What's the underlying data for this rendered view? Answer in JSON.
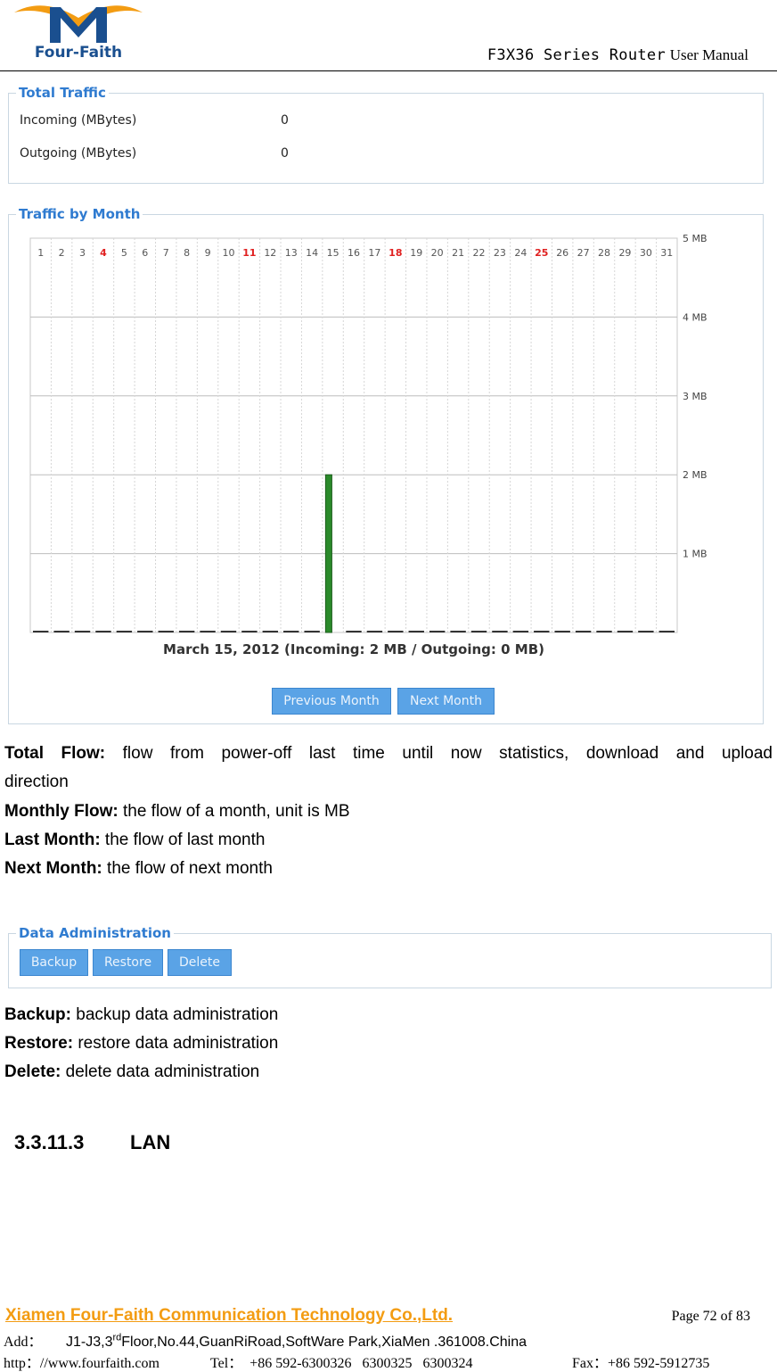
{
  "header": {
    "logo_text": "Four-Faith",
    "title_mono": "F3X36 Series Router",
    "title_serif": "User Manual"
  },
  "total_traffic": {
    "legend": "Total Traffic",
    "rows": [
      {
        "label": "Incoming (MBytes)",
        "value": "0"
      },
      {
        "label": "Outgoing (MBytes)",
        "value": "0"
      }
    ]
  },
  "traffic_by_month": {
    "legend": "Traffic by Month",
    "caption": "March 15, 2012 (Incoming: 2 MB / Outgoing: 0 MB)",
    "prev_button": "Previous Month",
    "next_button": "Next Month"
  },
  "chart_data": {
    "type": "bar",
    "categories": [
      "1",
      "2",
      "3",
      "4",
      "5",
      "6",
      "7",
      "8",
      "9",
      "10",
      "11",
      "12",
      "13",
      "14",
      "15",
      "16",
      "17",
      "18",
      "19",
      "20",
      "21",
      "22",
      "23",
      "24",
      "25",
      "26",
      "27",
      "28",
      "29",
      "30",
      "31"
    ],
    "highlight_days": [
      "4",
      "11",
      "18",
      "25"
    ],
    "highlight_color": "#e02020",
    "y_tick_labels": [
      "5 MB",
      "4 MB",
      "3 MB",
      "2 MB",
      "1 MB"
    ],
    "ylim": [
      0,
      5
    ],
    "bar_color": "#2a8a2a",
    "series": [
      {
        "values": [
          0,
          0,
          0,
          0,
          0,
          0,
          0,
          0,
          0,
          0,
          0,
          0,
          0,
          0,
          2,
          0,
          0,
          0,
          0,
          0,
          0,
          0,
          0,
          0,
          0,
          0,
          0,
          0,
          0,
          0,
          0
        ]
      }
    ],
    "grid": true
  },
  "text": {
    "total_flow_label": "Total Flow:",
    "total_flow_desc": " flow from power-off last time until now statistics, download and upload",
    "total_flow_desc2": "direction",
    "monthly_label": "Monthly Flow:",
    "monthly_desc": " the flow of a month, unit is MB",
    "last_label": "Last Month:",
    "last_desc": " the flow of last month",
    "next_label": "Next Month:",
    "next_desc": " the flow of next month",
    "backup_label": "Backup:",
    "backup_desc": " backup data administration",
    "restore_label": "Restore:",
    "restore_desc": " restore data administration",
    "delete_label": "Delete:",
    "delete_desc": " delete data administration",
    "section_number": "3.3.11.3",
    "section_title": "LAN"
  },
  "data_admin": {
    "legend": "Data Administration",
    "backup_button": "Backup",
    "restore_button": "Restore",
    "delete_button": "Delete"
  },
  "footer": {
    "company": "Xiamen Four-Faith Communication Technology Co.,Ltd.",
    "page": "Page 72 of 83",
    "addr_label": "Add：",
    "addr_pre": "J1-J3,3",
    "addr_sup": "rd",
    "addr_post": "Floor,No.44,GuanRiRoad,SoftWare Park,XiaMen .361008.China",
    "web": "http：//www.fourfaith.com",
    "tel": "Tel：  +86 592-6300326   6300325   6300324",
    "fax": "Fax：+86 592-5912735"
  }
}
